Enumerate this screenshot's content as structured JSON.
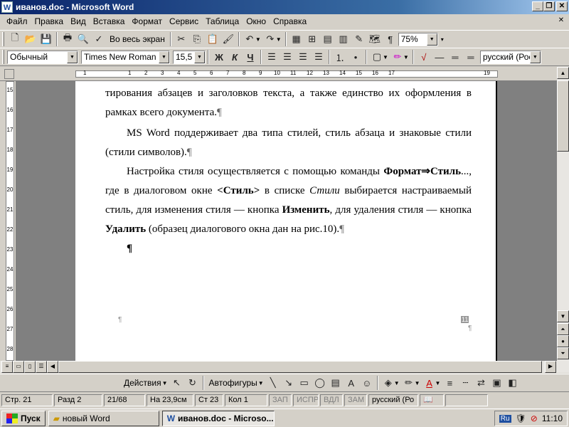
{
  "window": {
    "title": "иванов.doc - Microsoft Word",
    "app_icon": "W"
  },
  "menu": [
    "Файл",
    "Правка",
    "Вид",
    "Вставка",
    "Формат",
    "Сервис",
    "Таблица",
    "Окно",
    "Справка"
  ],
  "toolbar": {
    "fullscreen_label": "Во весь экран",
    "zoom": "75%"
  },
  "format_bar": {
    "style": "Обычный",
    "font": "Times New Roman",
    "size": "15,5",
    "bold": "Ж",
    "italic": "К",
    "underline": "Ч",
    "language": "русский (Росс"
  },
  "ruler_numbers": [
    "1",
    "1",
    "2",
    "3",
    "4",
    "5",
    "6",
    "7",
    "8",
    "9",
    "10",
    "11",
    "12",
    "13",
    "14",
    "15",
    "16",
    "17",
    "19"
  ],
  "vruler_numbers": [
    "15",
    "16",
    "17",
    "18",
    "19",
    "20",
    "21",
    "22",
    "23",
    "24",
    "25",
    "26",
    "27",
    "28"
  ],
  "document": {
    "p1": "тирования абзацев и заголовков текста, а также единство их оформления в рамках всего документа.",
    "p2": "MS Word поддерживает два типа стилей, стиль абзаца и знаковые стили (стили символов).",
    "p3_a": "Настройка стиля осуществляется с помощью команды ",
    "p3_b": "Формат⇒Стиль",
    "p3_c": "..., где в диалоговом окне ",
    "p3_d": "<Стиль>",
    "p3_e": " в списке ",
    "p3_f": "Стили",
    "p3_g": " выбирается настраиваемый стиль, для изменения стиля — кнопка ",
    "p3_h": "Изменить",
    "p3_i": ", для удаления стиля — кнопка ",
    "p3_j": "Удалить",
    "p3_k": " (образец диалогового окна дан на рис.10).",
    "pilcrow": "¶",
    "footer_num": "11"
  },
  "drawing": {
    "actions": "Действия",
    "autoshapes": "Автофигуры"
  },
  "status": {
    "page": "Стр. 21",
    "section": "Разд 2",
    "pages": "21/68",
    "at": "На 23,9см",
    "line": "Ст 23",
    "col": "Кол 1",
    "rec": "ЗАП",
    "trk": "ИСПР",
    "ext": "ВДЛ",
    "ovr": "ЗАМ",
    "lang": "русский (Ро"
  },
  "taskbar": {
    "start": "Пуск",
    "task1": "новый Word",
    "task2": "иванов.doc - Microso...",
    "lang": "Ru",
    "time": "11:10"
  }
}
